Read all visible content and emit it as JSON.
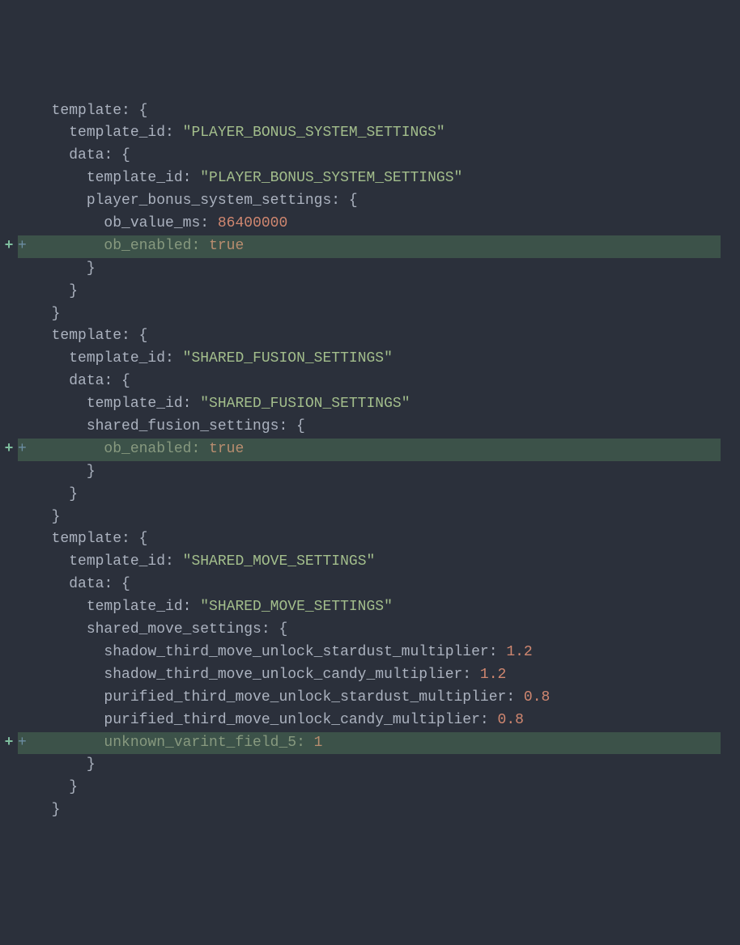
{
  "lines": [
    {
      "added": false,
      "indent": 1,
      "tokens": [
        [
          "k",
          "template"
        ],
        [
          "p",
          ": {"
        ]
      ]
    },
    {
      "added": false,
      "indent": 2,
      "tokens": [
        [
          "k",
          "template_id"
        ],
        [
          "p",
          ": "
        ],
        [
          "s",
          "\"PLAYER_BONUS_SYSTEM_SETTINGS\""
        ]
      ]
    },
    {
      "added": false,
      "indent": 2,
      "tokens": [
        [
          "k",
          "data"
        ],
        [
          "p",
          ": {"
        ]
      ]
    },
    {
      "added": false,
      "indent": 3,
      "tokens": [
        [
          "k",
          "template_id"
        ],
        [
          "p",
          ": "
        ],
        [
          "s",
          "\"PLAYER_BONUS_SYSTEM_SETTINGS\""
        ]
      ]
    },
    {
      "added": false,
      "indent": 3,
      "tokens": [
        [
          "k",
          "player_bonus_system_settings"
        ],
        [
          "p",
          ": {"
        ]
      ]
    },
    {
      "added": false,
      "indent": 4,
      "tokens": [
        [
          "k",
          "ob_value_ms"
        ],
        [
          "p",
          ": "
        ],
        [
          "n",
          "86400000"
        ]
      ]
    },
    {
      "added": true,
      "indent": 4,
      "tokens": [
        [
          "k",
          "ob_enabled"
        ],
        [
          "p",
          ": "
        ],
        [
          "b",
          "true"
        ]
      ]
    },
    {
      "added": false,
      "indent": 3,
      "tokens": [
        [
          "p",
          "}"
        ]
      ]
    },
    {
      "added": false,
      "indent": 2,
      "tokens": [
        [
          "p",
          "}"
        ]
      ]
    },
    {
      "added": false,
      "indent": 1,
      "tokens": [
        [
          "p",
          "}"
        ]
      ]
    },
    {
      "added": false,
      "indent": 1,
      "tokens": [
        [
          "k",
          "template"
        ],
        [
          "p",
          ": {"
        ]
      ]
    },
    {
      "added": false,
      "indent": 2,
      "tokens": [
        [
          "k",
          "template_id"
        ],
        [
          "p",
          ": "
        ],
        [
          "s",
          "\"SHARED_FUSION_SETTINGS\""
        ]
      ]
    },
    {
      "added": false,
      "indent": 2,
      "tokens": [
        [
          "k",
          "data"
        ],
        [
          "p",
          ": {"
        ]
      ]
    },
    {
      "added": false,
      "indent": 3,
      "tokens": [
        [
          "k",
          "template_id"
        ],
        [
          "p",
          ": "
        ],
        [
          "s",
          "\"SHARED_FUSION_SETTINGS\""
        ]
      ]
    },
    {
      "added": false,
      "indent": 3,
      "tokens": [
        [
          "k",
          "shared_fusion_settings"
        ],
        [
          "p",
          ": {"
        ]
      ]
    },
    {
      "added": true,
      "indent": 4,
      "tokens": [
        [
          "k",
          "ob_enabled"
        ],
        [
          "p",
          ": "
        ],
        [
          "b",
          "true"
        ]
      ]
    },
    {
      "added": false,
      "indent": 3,
      "tokens": [
        [
          "p",
          "}"
        ]
      ]
    },
    {
      "added": false,
      "indent": 2,
      "tokens": [
        [
          "p",
          "}"
        ]
      ]
    },
    {
      "added": false,
      "indent": 1,
      "tokens": [
        [
          "p",
          "}"
        ]
      ]
    },
    {
      "added": false,
      "indent": 1,
      "tokens": [
        [
          "k",
          "template"
        ],
        [
          "p",
          ": {"
        ]
      ]
    },
    {
      "added": false,
      "indent": 2,
      "tokens": [
        [
          "k",
          "template_id"
        ],
        [
          "p",
          ": "
        ],
        [
          "s",
          "\"SHARED_MOVE_SETTINGS\""
        ]
      ]
    },
    {
      "added": false,
      "indent": 2,
      "tokens": [
        [
          "k",
          "data"
        ],
        [
          "p",
          ": {"
        ]
      ]
    },
    {
      "added": false,
      "indent": 3,
      "tokens": [
        [
          "k",
          "template_id"
        ],
        [
          "p",
          ": "
        ],
        [
          "s",
          "\"SHARED_MOVE_SETTINGS\""
        ]
      ]
    },
    {
      "added": false,
      "indent": 3,
      "tokens": [
        [
          "k",
          "shared_move_settings"
        ],
        [
          "p",
          ": {"
        ]
      ]
    },
    {
      "added": false,
      "indent": 4,
      "tokens": [
        [
          "k",
          "shadow_third_move_unlock_stardust_multiplier"
        ],
        [
          "p",
          ": "
        ],
        [
          "n",
          "1.2"
        ]
      ]
    },
    {
      "added": false,
      "indent": 4,
      "tokens": [
        [
          "k",
          "shadow_third_move_unlock_candy_multiplier"
        ],
        [
          "p",
          ": "
        ],
        [
          "n",
          "1.2"
        ]
      ]
    },
    {
      "added": false,
      "indent": 4,
      "tokens": [
        [
          "k",
          "purified_third_move_unlock_stardust_multiplier"
        ],
        [
          "p",
          ": "
        ],
        [
          "n",
          "0.8"
        ]
      ]
    },
    {
      "added": false,
      "indent": 4,
      "tokens": [
        [
          "k",
          "purified_third_move_unlock_candy_multiplier"
        ],
        [
          "p",
          ": "
        ],
        [
          "n",
          "0.8"
        ]
      ]
    },
    {
      "added": true,
      "indent": 4,
      "tokens": [
        [
          "k",
          "unknown_varint_field_5"
        ],
        [
          "p",
          ": "
        ],
        [
          "n",
          "1"
        ]
      ]
    },
    {
      "added": false,
      "indent": 3,
      "tokens": [
        [
          "p",
          "}"
        ]
      ]
    },
    {
      "added": false,
      "indent": 2,
      "tokens": [
        [
          "p",
          "}"
        ]
      ]
    },
    {
      "added": false,
      "indent": 1,
      "tokens": [
        [
          "p",
          "}"
        ]
      ]
    }
  ],
  "markers": {
    "gutter_plus": "+",
    "inline_plus": "+"
  }
}
